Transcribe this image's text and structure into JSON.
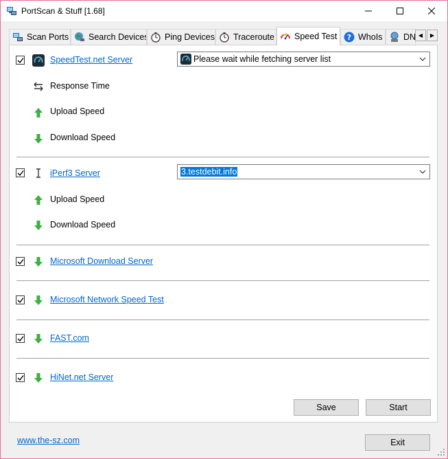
{
  "window": {
    "title": "PortScan & Stuff [1.68]",
    "controls": {
      "minimize": "minimize",
      "maximize": "maximize",
      "close": "close"
    }
  },
  "tabs": [
    {
      "label": "Scan Ports",
      "icon": "network-scan-icon",
      "active": false
    },
    {
      "label": "Search Devices",
      "icon": "globe-search-icon",
      "active": false
    },
    {
      "label": "Ping Devices",
      "icon": "stopwatch-icon",
      "active": false
    },
    {
      "label": "Traceroute",
      "icon": "stopwatch-icon",
      "active": false
    },
    {
      "label": "Speed Test",
      "icon": "speedometer-icon",
      "active": true
    },
    {
      "label": "WhoIs",
      "icon": "question-icon",
      "active": false
    },
    {
      "label": "DN",
      "icon": "dns-globe-icon",
      "active": false
    }
  ],
  "speedtest": {
    "server_link": "SpeedTest.net Server",
    "server_combo_value": "Please wait while fetching server list",
    "response_time": "Response Time",
    "upload": "Upload Speed",
    "download": "Download Speed"
  },
  "iperf": {
    "server_link": "iPerf3 Server",
    "server_combo_value": "3.testdebit.info",
    "upload": "Upload Speed",
    "download": "Download Speed"
  },
  "others": [
    {
      "label": "Microsoft Download Server"
    },
    {
      "label": "Microsoft Network Speed Test"
    },
    {
      "label": "FAST.com"
    },
    {
      "label": "HiNet.net Server"
    }
  ],
  "buttons": {
    "save": "Save",
    "start": "Start",
    "exit": "Exit"
  },
  "footer": {
    "link": "www.the-sz.com"
  },
  "colors": {
    "link": "#0066cc",
    "arrow_green": "#3cb043",
    "selection": "#0078d7",
    "accent_border": "#e86a9b"
  }
}
